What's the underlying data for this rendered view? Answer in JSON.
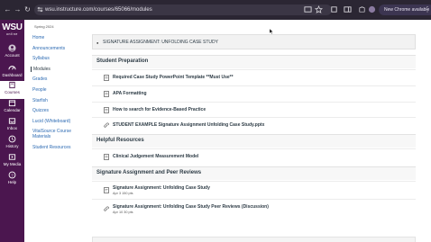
{
  "browser": {
    "url": "wsu.instructure.com/courses/65066/modules",
    "new_chrome": "New Chrome available"
  },
  "global_nav": {
    "logo": "WSU",
    "logo_sub": "online",
    "items": [
      {
        "label": "Account",
        "icon": "account-icon"
      },
      {
        "label": "Dashboard",
        "icon": "dashboard-icon"
      },
      {
        "label": "Courses",
        "icon": "courses-icon",
        "active": true
      },
      {
        "label": "Calendar",
        "icon": "calendar-icon"
      },
      {
        "label": "Inbox",
        "icon": "inbox-icon"
      },
      {
        "label": "History",
        "icon": "history-icon"
      },
      {
        "label": "My Media",
        "icon": "media-icon"
      },
      {
        "label": "Help",
        "icon": "help-icon"
      }
    ]
  },
  "course": {
    "term": "Spring 2024",
    "nav": [
      "Home",
      "Announcements",
      "Syllabus",
      "Modules",
      "Grades",
      "People",
      "Starfish",
      "Quizzes",
      "Lucid (Whiteboard)",
      "VitalSource Course",
      "Materials",
      "Student Resources"
    ]
  },
  "module": {
    "title": "SIGNATURE ASSIGNMENT: UNFOLDING CASE STUDY",
    "sections": [
      {
        "title": "Student Preparation"
      },
      {
        "title": "Helpful Resources"
      },
      {
        "title": "Signature Assignment and Peer Reviews"
      }
    ],
    "items": [
      {
        "title": "Required Case Study PowerPoint Template **Must Use**",
        "icon": "page-icon"
      },
      {
        "title": "APA Formatting",
        "icon": "page-icon"
      },
      {
        "title": "How to search for Evidence-Based Practice",
        "icon": "page-icon"
      },
      {
        "title": "STUDENT EXAMPLE Signature Assignment Unfolding Case Study.pptx",
        "icon": "attachment-icon"
      },
      {
        "title": "Clinical Judgement Measurement Model",
        "icon": "page-icon"
      },
      {
        "title": "Signature Assignment: Unfolding Case Study",
        "meta": "Apr 3  150 pts",
        "icon": "assignment-icon"
      },
      {
        "title": "Signature Assignment: Unfolding Case Study Peer Reviews (Discussion)",
        "meta": "Apr 10  30 pts",
        "icon": "discussion-icon"
      }
    ]
  }
}
